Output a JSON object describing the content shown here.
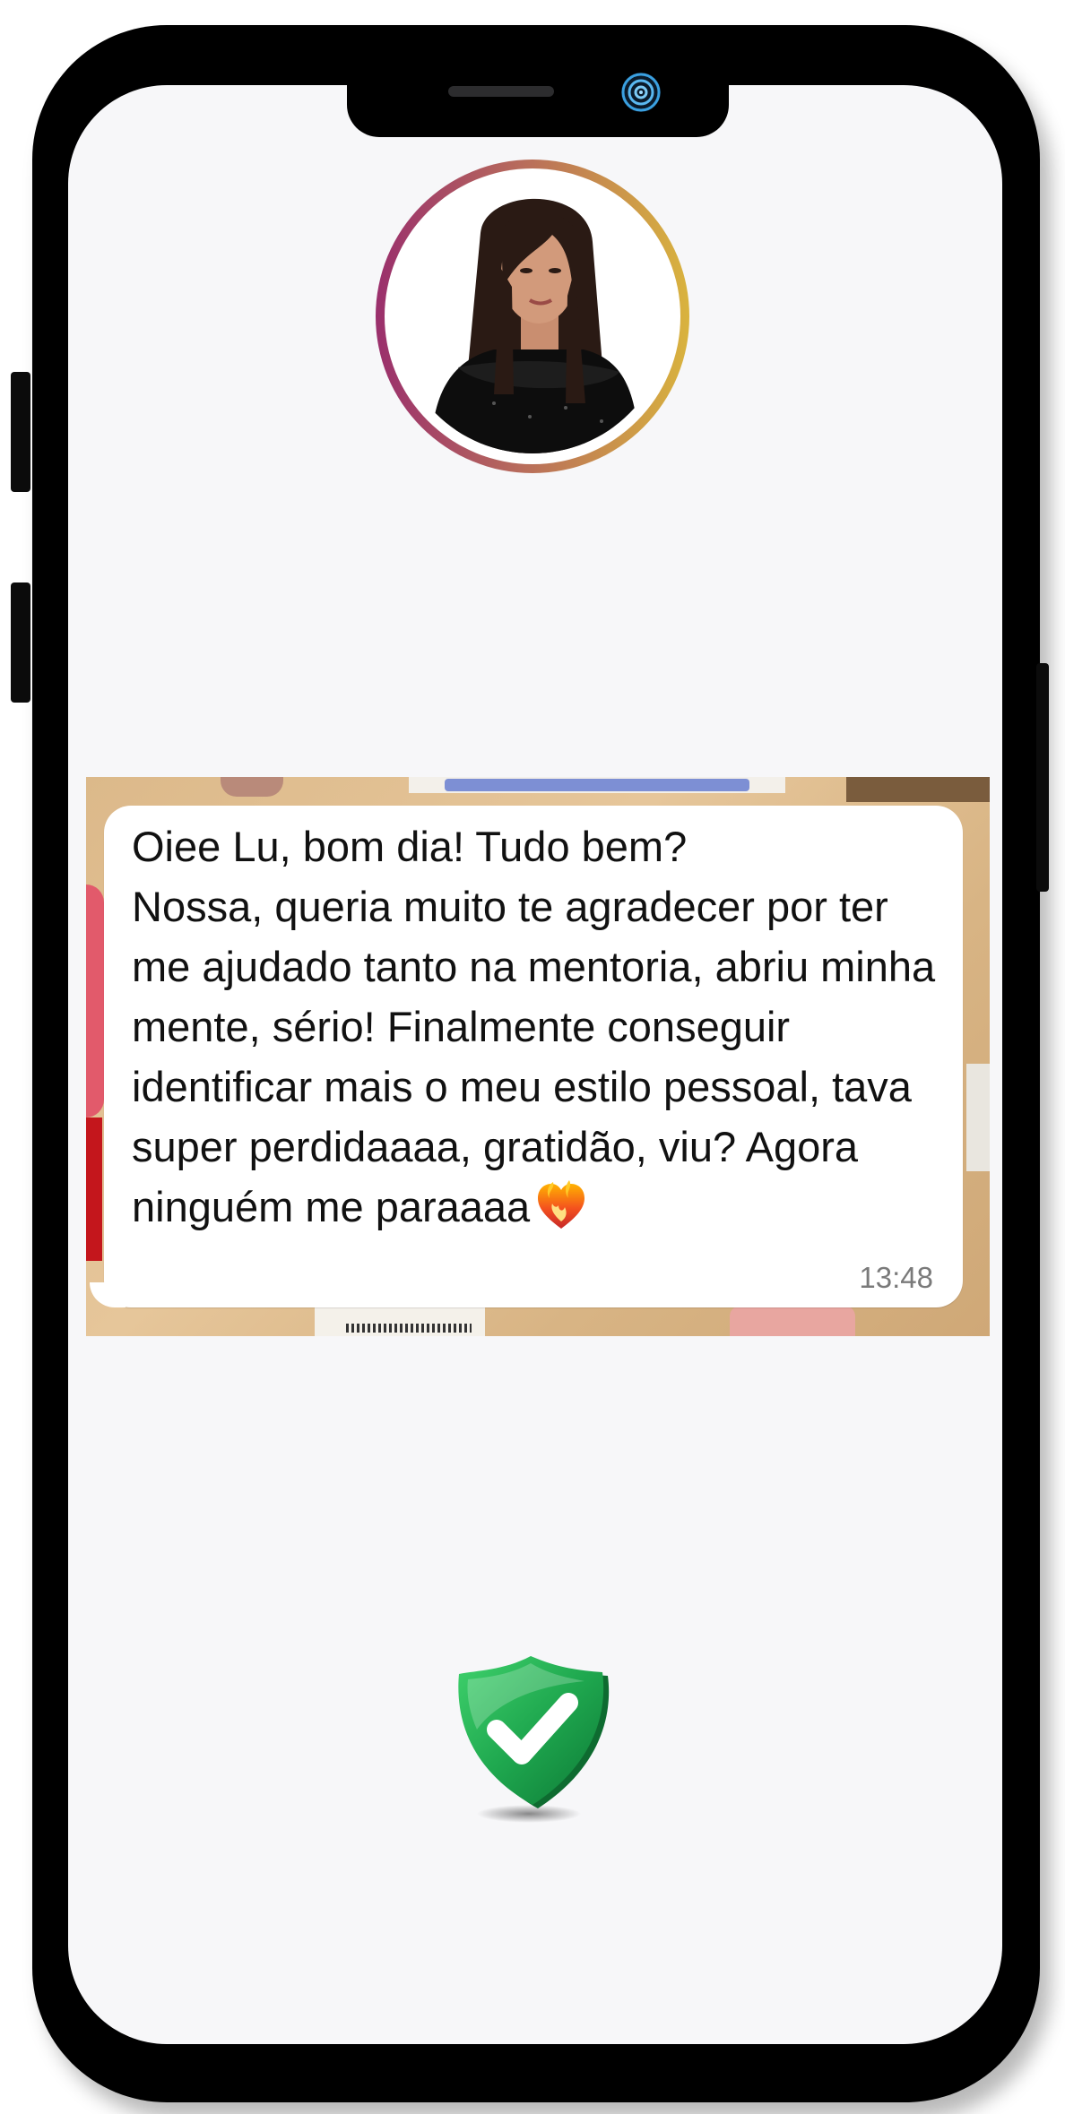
{
  "profile": {
    "avatar_icon": "profile-photo-woman"
  },
  "message": {
    "text": "Oiee Lu, bom dia! Tudo bem?\nNossa, queria muito te agradecer por ter me ajudado tanto na mentoria, abriu minha mente, sério! Finalmente conseguir identificar mais o meu estilo pessoal, tava super perdidaaaa, gratidão, viu? Agora ninguém me paraaaa",
    "emoji_icon": "heart-on-fire-icon",
    "time": "13:48"
  },
  "badge": {
    "icon": "verified-shield-check-icon",
    "color": "#1fa84f"
  },
  "colors": {
    "frame": "#000000",
    "screen": "#f7f7f9",
    "ring_start": "#9a2f6c",
    "ring_end": "#d9b33e",
    "bubble": "#ffffff",
    "time_text": "#7a7a7a"
  }
}
